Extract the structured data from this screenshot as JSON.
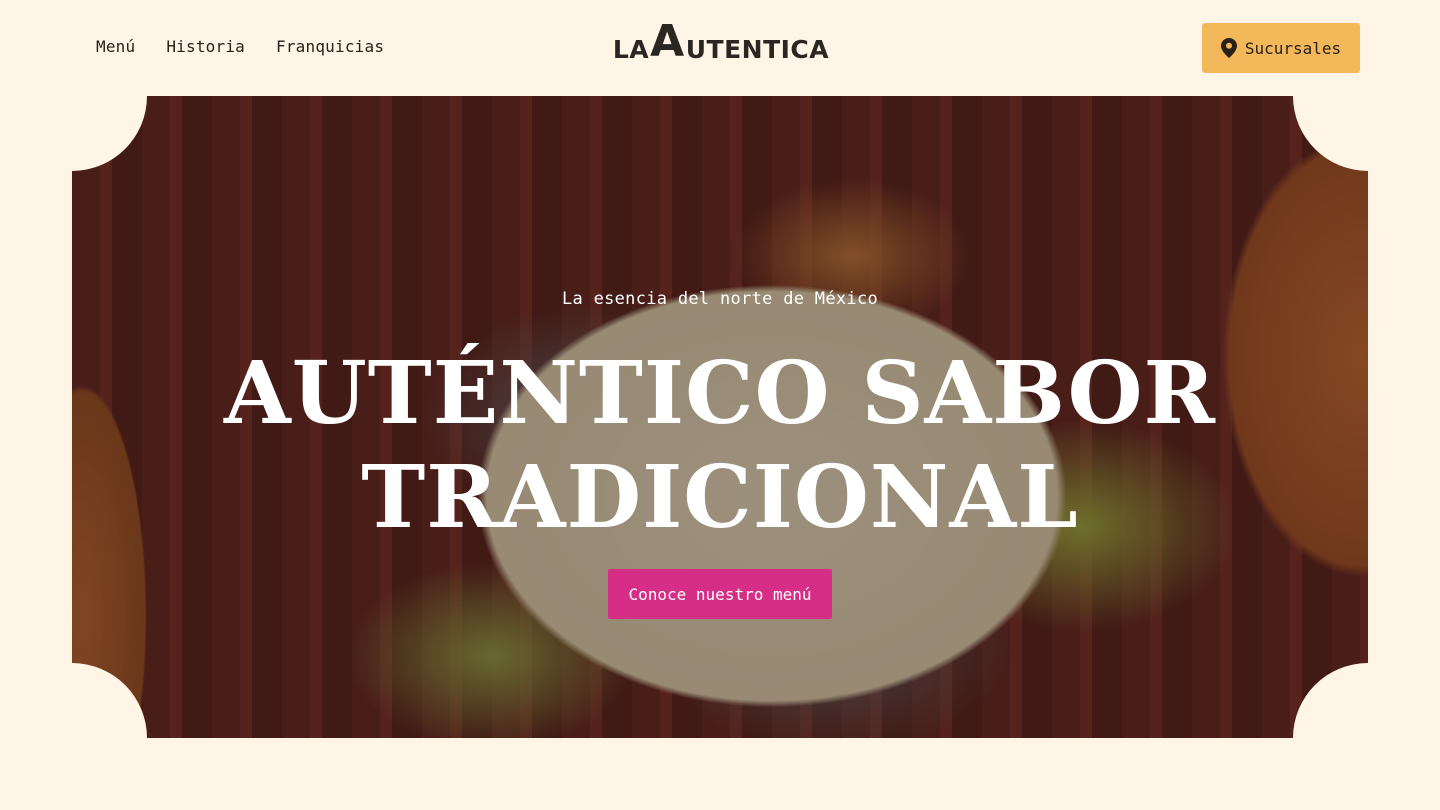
{
  "nav": {
    "items": [
      {
        "label": "Menú"
      },
      {
        "label": "Historia"
      },
      {
        "label": "Franquicias"
      }
    ]
  },
  "logo": {
    "part1": "LA",
    "part2": "A",
    "part3": "UTENTICA"
  },
  "branches_button": {
    "label": "Sucursales",
    "icon": "location-pin-icon"
  },
  "hero": {
    "tagline": "La esencia del norte de México",
    "headline_line1": "AUTÉNTICO SABOR",
    "headline_line2": "TRADICIONAL",
    "cta_label": "Conoce nuestro menú"
  },
  "colors": {
    "background": "#fff5e6",
    "accent_yellow": "#f3b85a",
    "accent_pink": "#d62e87"
  }
}
